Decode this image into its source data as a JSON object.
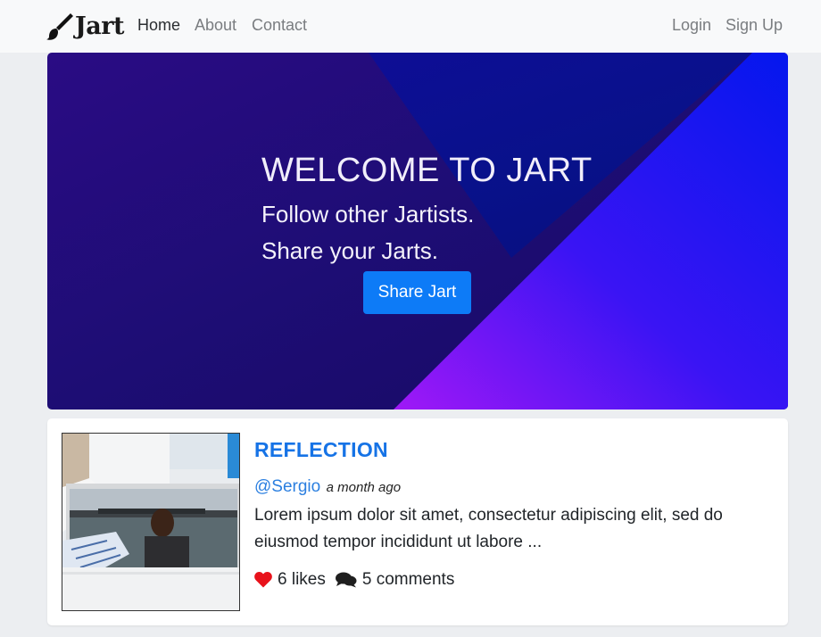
{
  "navbar": {
    "brand": "Jart",
    "links": [
      "Home",
      "About",
      "Contact"
    ],
    "auth": [
      "Login",
      "Sign Up"
    ]
  },
  "hero": {
    "title": "WELCOME TO JART",
    "line1": "Follow other Jartists.",
    "line2": "Share your Jarts.",
    "button": "Share Jart"
  },
  "post": {
    "title": "REFLECTION",
    "author": "@Sergio",
    "time": "a month ago",
    "excerpt": "Lorem ipsum dolor sit amet, consectetur adipiscing elit, sed do eiusmod tempor incididunt ut labore ...",
    "likes": "6 likes",
    "comments": "5 comments"
  },
  "colors": {
    "accent": "#0d7bf7",
    "link": "#1673e6",
    "heart": "#e8121b",
    "hero_dark": "#1c0c6e",
    "hero_blue": "#0417ee",
    "hero_purple": "#9a18f6"
  },
  "icons": {
    "brand": "paintbrush-icon",
    "likes": "heart-icon",
    "comments": "comments-icon"
  }
}
